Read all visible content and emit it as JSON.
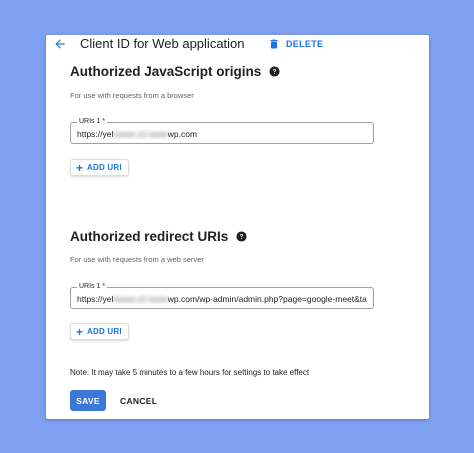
{
  "header": {
    "title": "Client ID for Web application",
    "delete_label": "DELETE",
    "back_icon": "arrow-back-icon",
    "delete_icon": "trash-icon"
  },
  "js_origins": {
    "title": "Authorized JavaScript origins",
    "subtitle": "For use with requests from a browser",
    "field_label": "URIs 1 *",
    "value_prefix": "https://yel",
    "value_blurred": "lowse.s2-taste",
    "value_suffix": "wp.com",
    "add_label": "ADD URI"
  },
  "redirect_uris": {
    "title": "Authorized redirect URIs",
    "subtitle": "For use with requests from a web server",
    "field_label": "URIs 1 *",
    "value_prefix": "https://yel",
    "value_blurred": "lowse.s2-taste",
    "value_suffix": "wp.com/wp-admin/admin.php?page=google-meet&ta",
    "add_label": "ADD URI"
  },
  "note": "Note: It may take 5 minutes to a few hours for settings to take effect",
  "actions": {
    "save_label": "SAVE",
    "cancel_label": "CANCEL"
  },
  "colors": {
    "accent": "#1a73e8",
    "save_bg": "#3c78d8",
    "page_bg": "#7f9ff0"
  }
}
